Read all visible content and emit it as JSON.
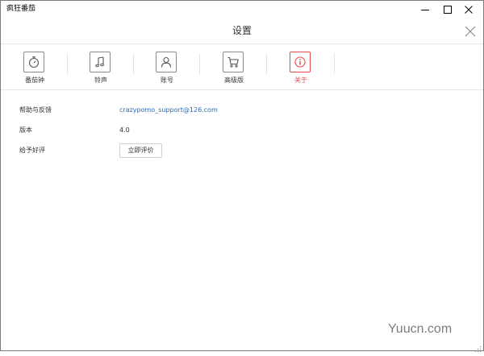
{
  "window": {
    "title": "疯狂番茄",
    "controls": {
      "minimize_icon": "minimize-icon",
      "maximize_icon": "maximize-icon",
      "close_icon": "close-icon"
    }
  },
  "dialog": {
    "title": "设置",
    "close_icon": "close-icon"
  },
  "tabs": [
    {
      "label": "番茄钟",
      "icon": "stopwatch-icon",
      "active": false
    },
    {
      "label": "铃声",
      "icon": "music-note-icon",
      "active": false
    },
    {
      "label": "账号",
      "icon": "user-icon",
      "active": false
    },
    {
      "label": "高级版",
      "icon": "shopping-cart-icon",
      "active": false
    },
    {
      "label": "关于",
      "icon": "info-icon",
      "active": true
    }
  ],
  "about": {
    "help_label": "帮助与反馈",
    "help_email": "crazypomo_support@126.com",
    "version_label": "版本",
    "version_value": "4.0",
    "rate_label": "给予好评",
    "rate_button": "立即评价"
  },
  "watermark": "Yuucn.com",
  "colors": {
    "accent": "#e8474b",
    "link": "#2a6ab5",
    "icon_border": "#8a8a8a",
    "divider": "#e6e6e6"
  }
}
